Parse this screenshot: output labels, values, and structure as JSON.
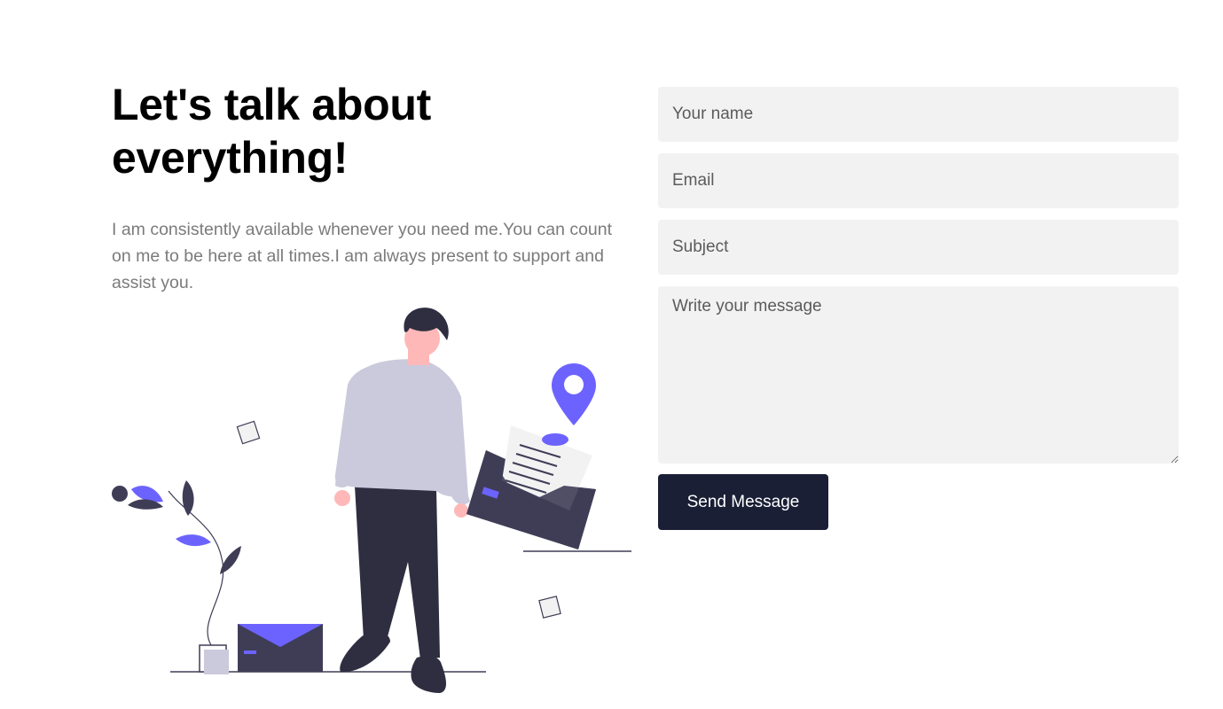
{
  "hero": {
    "heading": "Let's talk about everything!",
    "lead": "I am consistently available whenever you need me.You can count on me to be here at all times.I am always present to support and assist you."
  },
  "form": {
    "name_placeholder": "Your name",
    "email_placeholder": "Email",
    "subject_placeholder": "Subject",
    "message_placeholder": "Write your message",
    "submit_label": "Send Message"
  },
  "colors": {
    "accent": "#6c63ff",
    "button": "#1a1f36",
    "field_bg": "#f2f2f2",
    "lead_text": "#7b7b7b"
  }
}
